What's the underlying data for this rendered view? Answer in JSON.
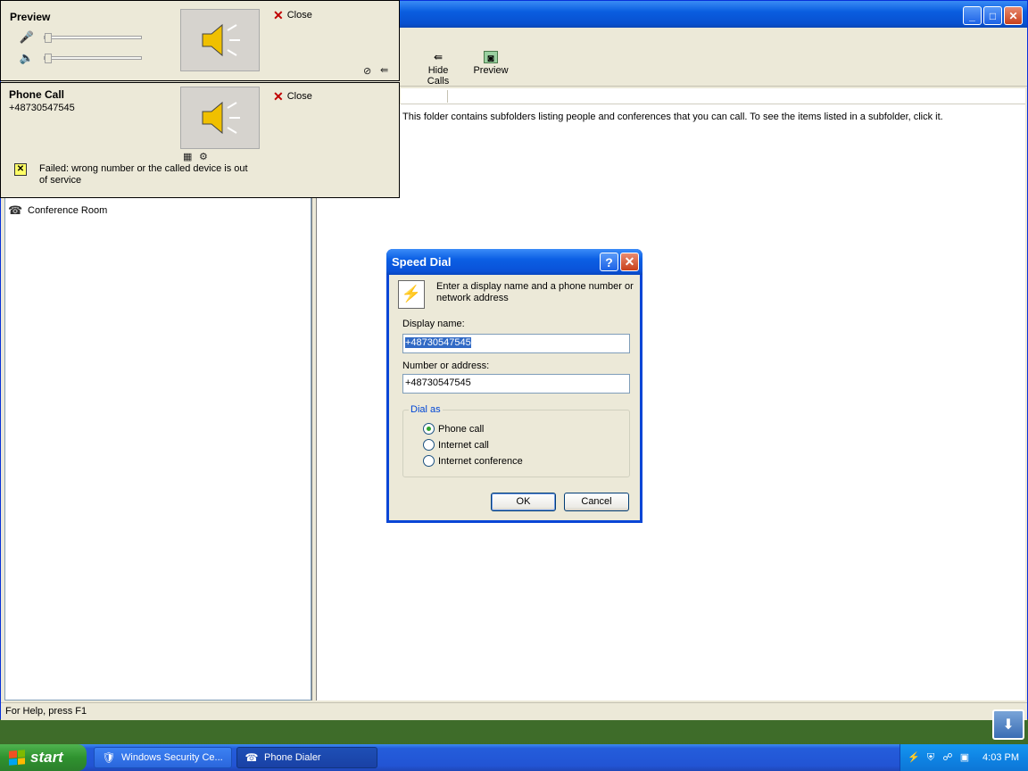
{
  "main_window": {
    "toolbar": {
      "hide_calls_label": "Hide Calls",
      "preview_label": "Preview"
    },
    "folder_message": "This folder contains subfolders listing people and conferences that you can call. To see the items listed in a subfolder, click it.",
    "tree": {
      "conference_room": "Conference Room"
    },
    "status_bar": "For Help, press F1"
  },
  "preview_panel": {
    "title": "Preview",
    "close_label": "Close",
    "microphone_level": 0.0,
    "speaker_level": 0.0
  },
  "call_panel": {
    "title": "Phone Call",
    "number": "+48730547545",
    "close_label": "Close",
    "status_text": "Failed:  wrong number or the called device is out of service"
  },
  "speed_dial": {
    "title": "Speed Dial",
    "help_btn": "?",
    "close_btn": "✕",
    "instructions": "Enter a display name and a phone number or network address",
    "display_name_label": "Display name:",
    "display_name_value": "+48730547545",
    "number_label": "Number or address:",
    "number_value": "+48730547545",
    "dial_as_label": "Dial as",
    "options": [
      "Phone call",
      "Internet call",
      "Internet conference"
    ],
    "selected_option": "Phone call",
    "ok_label": "OK",
    "cancel_label": "Cancel"
  },
  "taskbar": {
    "start_label": "start",
    "tasks": [
      "Windows Security Ce...",
      "Phone Dialer"
    ],
    "active_task": "Phone Dialer",
    "clock": "4:03 PM"
  }
}
